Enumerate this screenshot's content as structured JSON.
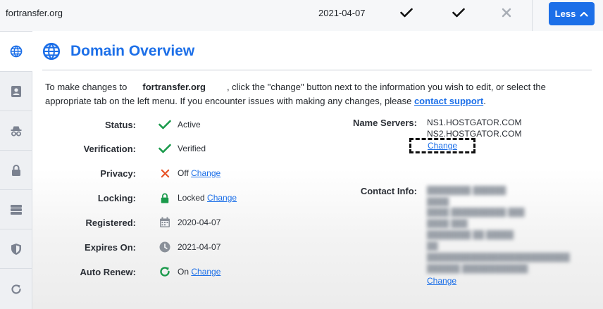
{
  "top_row": {
    "domain": "fortransfer.org",
    "date": "2021-04-07",
    "less_label": "Less"
  },
  "sidebar": {
    "tabs": [
      {
        "icon": "globe-icon",
        "active": true
      },
      {
        "icon": "contact-card-icon"
      },
      {
        "icon": "incognito-icon"
      },
      {
        "icon": "lock-icon"
      },
      {
        "icon": "server-icon"
      },
      {
        "icon": "shield-icon"
      },
      {
        "icon": "refresh-icon"
      }
    ]
  },
  "main": {
    "title": "Domain Overview",
    "intro_prefix": "To make changes to",
    "intro_domain": "fortransfer.org",
    "intro_middle": ", click the \"change\" button next to the information you wish to edit, or select the appropriate tab on the left menu. If you encounter issues with making any changes, please",
    "intro_link": "contact support",
    "intro_suffix": ".",
    "details": {
      "status": {
        "label": "Status:",
        "value": "Active"
      },
      "verification": {
        "label": "Verification:",
        "value": "Verified"
      },
      "privacy": {
        "label": "Privacy:",
        "value": "Off",
        "change": "Change"
      },
      "locking": {
        "label": "Locking:",
        "value": "Locked",
        "change": "Change"
      },
      "registered": {
        "label": "Registered:",
        "value": "2020-04-07"
      },
      "expires": {
        "label": "Expires On:",
        "value": "2021-04-07"
      },
      "auto_renew": {
        "label": "Auto Renew:",
        "value": "On",
        "change": "Change"
      }
    },
    "name_servers": {
      "label": "Name Servers:",
      "ns1": "NS1.HOSTGATOR.COM",
      "ns2": "NS2.HOSTGATOR.COM",
      "change": "Change"
    },
    "contact_info": {
      "label": "Contact Info:",
      "change": "Change"
    }
  },
  "colors": {
    "accent": "#1c6fe8",
    "success": "#1a9a4b",
    "danger": "#e8562a",
    "muted": "#8a9099"
  }
}
